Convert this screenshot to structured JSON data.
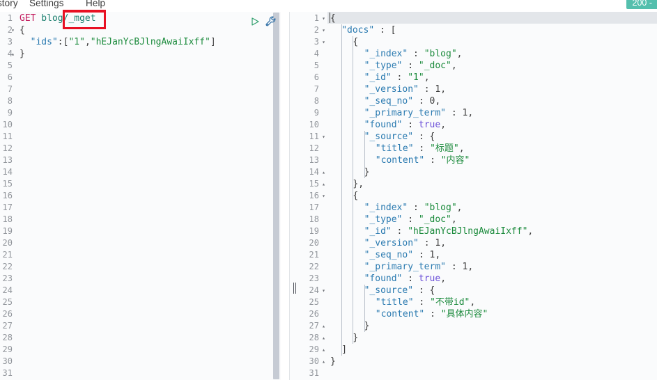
{
  "menubar": {
    "items": [
      {
        "label": "History"
      },
      {
        "label": "Settings"
      },
      {
        "label": "Help"
      }
    ]
  },
  "status_badge": {
    "label": "200 -",
    "color": "#54bfad"
  },
  "annotation": {
    "shape": "rectangle",
    "color": "#e81123",
    "target_text": "/_mget"
  },
  "toolbar": {
    "play_label": "send-request",
    "wrench_label": "request-options"
  },
  "request_panel": {
    "gutter": [
      "1",
      "2",
      "3",
      "4",
      "5",
      "6",
      "7",
      "8",
      "9",
      "10",
      "11",
      "12",
      "13",
      "14",
      "15",
      "16",
      "17",
      "18",
      "19",
      "20",
      "21",
      "22",
      "23",
      "24",
      "25",
      "26",
      "27",
      "28",
      "29",
      "30",
      "31"
    ],
    "lines": [
      {
        "n": 1,
        "method": "GET",
        "url": " blog/_mget"
      },
      {
        "n": 2,
        "text": "{"
      },
      {
        "n": 3,
        "key": "\"ids\"",
        "sep": ":[",
        "v1": "\"1\"",
        "comma": ",",
        "v2": "\"hEJanYcBJlngAwaiIxff\"",
        "close": "]"
      },
      {
        "n": 4,
        "text": "}"
      }
    ],
    "folds": {
      "2": "down",
      "4": "up"
    }
  },
  "response_panel": {
    "gutter": [
      "1",
      "2",
      "3",
      "4",
      "5",
      "6",
      "7",
      "8",
      "9",
      "10",
      "11",
      "12",
      "13",
      "14",
      "15",
      "16",
      "17",
      "18",
      "19",
      "20",
      "21",
      "22",
      "23",
      "24",
      "25",
      "26",
      "27",
      "28",
      "29",
      "30",
      "31"
    ],
    "folds": {
      "1": "down",
      "2": "down",
      "3": "down",
      "11": "down",
      "14": "up",
      "15": "up",
      "16": "down",
      "24": "down",
      "27": "up",
      "28": "up",
      "29": "up",
      "30": "up"
    },
    "lines": [
      {
        "n": 1,
        "indent": 0,
        "tokens": [
          [
            "punct",
            "{"
          ]
        ]
      },
      {
        "n": 2,
        "indent": 1,
        "tokens": [
          [
            "key",
            "\"docs\""
          ],
          [
            "punct",
            " : ["
          ]
        ]
      },
      {
        "n": 3,
        "indent": 2,
        "tokens": [
          [
            "punct",
            "{"
          ]
        ]
      },
      {
        "n": 4,
        "indent": 3,
        "tokens": [
          [
            "key",
            "\"_index\""
          ],
          [
            "punct",
            " : "
          ],
          [
            "str",
            "\"blog\""
          ],
          [
            "punct",
            ","
          ]
        ]
      },
      {
        "n": 5,
        "indent": 3,
        "tokens": [
          [
            "key",
            "\"_type\""
          ],
          [
            "punct",
            " : "
          ],
          [
            "str",
            "\"_doc\""
          ],
          [
            "punct",
            ","
          ]
        ]
      },
      {
        "n": 6,
        "indent": 3,
        "tokens": [
          [
            "key",
            "\"_id\""
          ],
          [
            "punct",
            " : "
          ],
          [
            "str",
            "\"1\""
          ],
          [
            "punct",
            ","
          ]
        ]
      },
      {
        "n": 7,
        "indent": 3,
        "tokens": [
          [
            "key",
            "\"_version\""
          ],
          [
            "punct",
            " : "
          ],
          [
            "num",
            "1"
          ],
          [
            "punct",
            ","
          ]
        ]
      },
      {
        "n": 8,
        "indent": 3,
        "tokens": [
          [
            "key",
            "\"_seq_no\""
          ],
          [
            "punct",
            " : "
          ],
          [
            "num",
            "0"
          ],
          [
            "punct",
            ","
          ]
        ]
      },
      {
        "n": 9,
        "indent": 3,
        "tokens": [
          [
            "key",
            "\"_primary_term\""
          ],
          [
            "punct",
            " : "
          ],
          [
            "num",
            "1"
          ],
          [
            "punct",
            ","
          ]
        ]
      },
      {
        "n": 10,
        "indent": 3,
        "tokens": [
          [
            "key",
            "\"found\""
          ],
          [
            "punct",
            " : "
          ],
          [
            "bool",
            "true"
          ],
          [
            "punct",
            ","
          ]
        ]
      },
      {
        "n": 11,
        "indent": 3,
        "tokens": [
          [
            "key",
            "\"_source\""
          ],
          [
            "punct",
            " : {"
          ]
        ]
      },
      {
        "n": 12,
        "indent": 4,
        "tokens": [
          [
            "key",
            "\"title\""
          ],
          [
            "punct",
            " : "
          ],
          [
            "str",
            "\"标题\""
          ],
          [
            "punct",
            ","
          ]
        ]
      },
      {
        "n": 13,
        "indent": 4,
        "tokens": [
          [
            "key",
            "\"content\""
          ],
          [
            "punct",
            " : "
          ],
          [
            "str",
            "\"内容\""
          ]
        ]
      },
      {
        "n": 14,
        "indent": 3,
        "tokens": [
          [
            "punct",
            "}"
          ]
        ]
      },
      {
        "n": 15,
        "indent": 2,
        "tokens": [
          [
            "punct",
            "},"
          ]
        ]
      },
      {
        "n": 16,
        "indent": 2,
        "tokens": [
          [
            "punct",
            "{"
          ]
        ]
      },
      {
        "n": 17,
        "indent": 3,
        "tokens": [
          [
            "key",
            "\"_index\""
          ],
          [
            "punct",
            " : "
          ],
          [
            "str",
            "\"blog\""
          ],
          [
            "punct",
            ","
          ]
        ]
      },
      {
        "n": 18,
        "indent": 3,
        "tokens": [
          [
            "key",
            "\"_type\""
          ],
          [
            "punct",
            " : "
          ],
          [
            "str",
            "\"_doc\""
          ],
          [
            "punct",
            ","
          ]
        ]
      },
      {
        "n": 19,
        "indent": 3,
        "tokens": [
          [
            "key",
            "\"_id\""
          ],
          [
            "punct",
            " : "
          ],
          [
            "str",
            "\"hEJanYcBJlngAwaiIxff\""
          ],
          [
            "punct",
            ","
          ]
        ]
      },
      {
        "n": 20,
        "indent": 3,
        "tokens": [
          [
            "key",
            "\"_version\""
          ],
          [
            "punct",
            " : "
          ],
          [
            "num",
            "1"
          ],
          [
            "punct",
            ","
          ]
        ]
      },
      {
        "n": 21,
        "indent": 3,
        "tokens": [
          [
            "key",
            "\"_seq_no\""
          ],
          [
            "punct",
            " : "
          ],
          [
            "num",
            "1"
          ],
          [
            "punct",
            ","
          ]
        ]
      },
      {
        "n": 22,
        "indent": 3,
        "tokens": [
          [
            "key",
            "\"_primary_term\""
          ],
          [
            "punct",
            " : "
          ],
          [
            "num",
            "1"
          ],
          [
            "punct",
            ","
          ]
        ]
      },
      {
        "n": 23,
        "indent": 3,
        "tokens": [
          [
            "key",
            "\"found\""
          ],
          [
            "punct",
            " : "
          ],
          [
            "bool",
            "true"
          ],
          [
            "punct",
            ","
          ]
        ]
      },
      {
        "n": 24,
        "indent": 3,
        "tokens": [
          [
            "key",
            "\"_source\""
          ],
          [
            "punct",
            " : {"
          ]
        ]
      },
      {
        "n": 25,
        "indent": 4,
        "tokens": [
          [
            "key",
            "\"title\""
          ],
          [
            "punct",
            " : "
          ],
          [
            "str",
            "\"不带id\""
          ],
          [
            "punct",
            ","
          ]
        ]
      },
      {
        "n": 26,
        "indent": 4,
        "tokens": [
          [
            "key",
            "\"content\""
          ],
          [
            "punct",
            " : "
          ],
          [
            "str",
            "\"具体内容\""
          ]
        ]
      },
      {
        "n": 27,
        "indent": 3,
        "tokens": [
          [
            "punct",
            "}"
          ]
        ]
      },
      {
        "n": 28,
        "indent": 2,
        "tokens": [
          [
            "punct",
            "}"
          ]
        ]
      },
      {
        "n": 29,
        "indent": 1,
        "tokens": [
          [
            "punct",
            "]"
          ]
        ]
      },
      {
        "n": 30,
        "indent": 0,
        "tokens": [
          [
            "punct",
            "}"
          ]
        ]
      },
      {
        "n": 31,
        "indent": 0,
        "tokens": []
      }
    ]
  }
}
